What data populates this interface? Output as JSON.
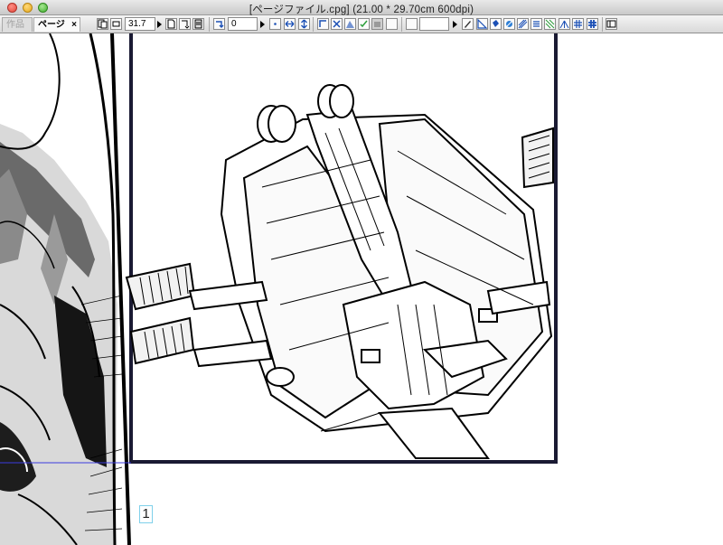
{
  "window": {
    "title": "[ページファイル.cpg] (21.00 * 29.70cm 600dpi)"
  },
  "tabs": [
    {
      "label": "作品",
      "active": false
    },
    {
      "label": "ページ",
      "active": true,
      "close": "×"
    }
  ],
  "toolbar": {
    "zoom_value": "31.7",
    "rotate_value": "0",
    "blank_value": ""
  },
  "canvas": {
    "page_number": "1",
    "frame_color": "#1a1a33",
    "guide_color": "#3a3adf",
    "page_number_border": "#7fd0ea"
  }
}
